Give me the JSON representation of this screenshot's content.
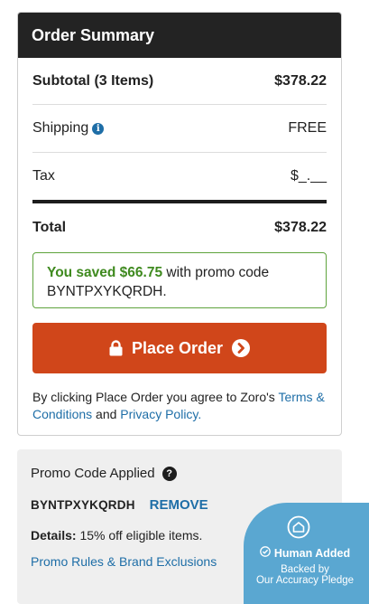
{
  "summary": {
    "header": "Order Summary",
    "subtotal_label": "Subtotal (3 Items)",
    "subtotal_value": "$378.22",
    "shipping_label": "Shipping",
    "shipping_value": "FREE",
    "tax_label": "Tax",
    "tax_value": "$_.__",
    "total_label": "Total",
    "total_value": "$378.22"
  },
  "savings": {
    "saved_text": "You saved $66.75",
    "rest_text": " with promo code BYNTPXYKQRDH."
  },
  "place_order": {
    "label": "Place Order",
    "lock_icon": "lock-icon",
    "arrow_icon": "chevron-circle-right-icon"
  },
  "agreement": {
    "prefix": "By clicking Place Order you agree to Zoro's ",
    "terms_link": "Terms & Conditions",
    "and_text": " and ",
    "privacy_link": "Privacy Policy."
  },
  "promo": {
    "title": "Promo Code Applied",
    "code": "BYNTPXYKQRDH",
    "remove_label": "REMOVE",
    "details_label": "Details:",
    "details_text": " 15% off eligible items.",
    "rules_link": "Promo Rules & Brand Exclusions"
  },
  "badge": {
    "title": "Human Added",
    "sub_line1": "Backed by",
    "sub_line2": "Our Accuracy Pledge"
  },
  "colors": {
    "header_bg": "#232323",
    "place_order_bg": "#d0461a",
    "savings_green": "#3f8a1f",
    "link_blue": "#1e6ea7",
    "badge_bg": "#5aa7d1"
  }
}
